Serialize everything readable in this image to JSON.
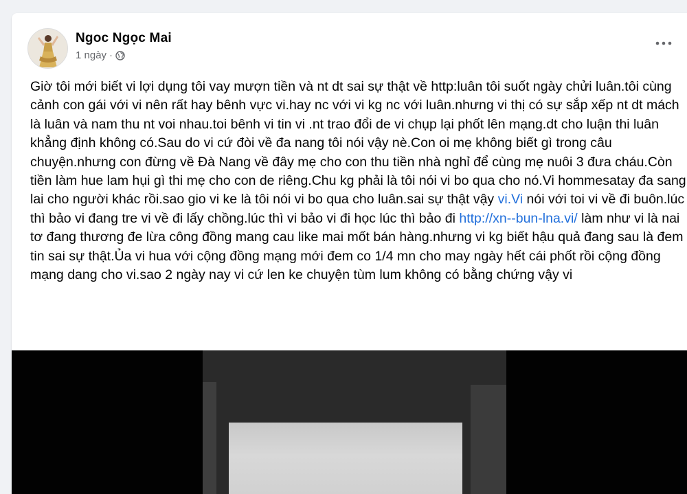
{
  "post": {
    "author": "Ngoc Ngọc Mai",
    "time": "1 ngày",
    "separator": "·",
    "privacy_icon": "globe-icon",
    "more_icon": "more-options-icon",
    "text_segments": {
      "t1": "Giờ tôi mới biết vi lợi dụng tôi vay mượn tiền  và nt dt sai sự thật về http:luân tôi suốt ngày chửi luân.tôi cùng cảnh con gái với vi nên rất hay bênh vực vi.hay nc với vi kg nc với luân.nhưng vi thị có sự sắp xếp nt dt mách là luân và nam thu nt voi nhau.toi bênh vi tin vi .nt trao đổi de vi chụp lại phốt lên mạng.dt cho luận thi luân khẳng định không có.Sau do vi cứ đòi về đa nang tôi nói vậy nè.Con oi mẹ không biết gì trong câu chuyện.nhưng con đừng về Đà Nang về đây mẹ cho con thu tiền nhà nghỉ để cùng mẹ nuôi 3 đưa cháu.Còn tiền làm hue lam hụi gì thi mẹ cho con de riêng.Chu kg phải là tôi nói vi bo qua cho nó.Vi hommesatay đa sang lai cho người khác rồi.sao gio vi ke là tôi nói vi bo qua cho luân.sai sự thật vậy ",
      "link1": "vi.Vi",
      "t2": " nói với toi vi về đi buôn.lúc thì bảo vi đang tre vi về đi lấy chồng.lúc thì vi bảo vi đi học lúc thì bảo đi ",
      "link2": "http://xn--bun-lna.vi/",
      "t3": " làm  như vi là nai tơ đang thương đe lừa công đồng mang cau like mai mốt bán hàng.nhưng vi kg biết hậu quả đang sau là đem tin sai sự thật.Ủa vi hua với cộng đồng mạng mới đem co 1/4 mn cho may ngày hết cái phốt rồi cộng đồng mạng dang cho vi.sao 2 ngày nay vi cứ len ke chuyện tùm lum không có bằng chứng vậy vi"
    },
    "colors": {
      "link": "#216fdb",
      "text": "#050505",
      "meta": "#65676b",
      "background": "#f0f2f5"
    }
  }
}
